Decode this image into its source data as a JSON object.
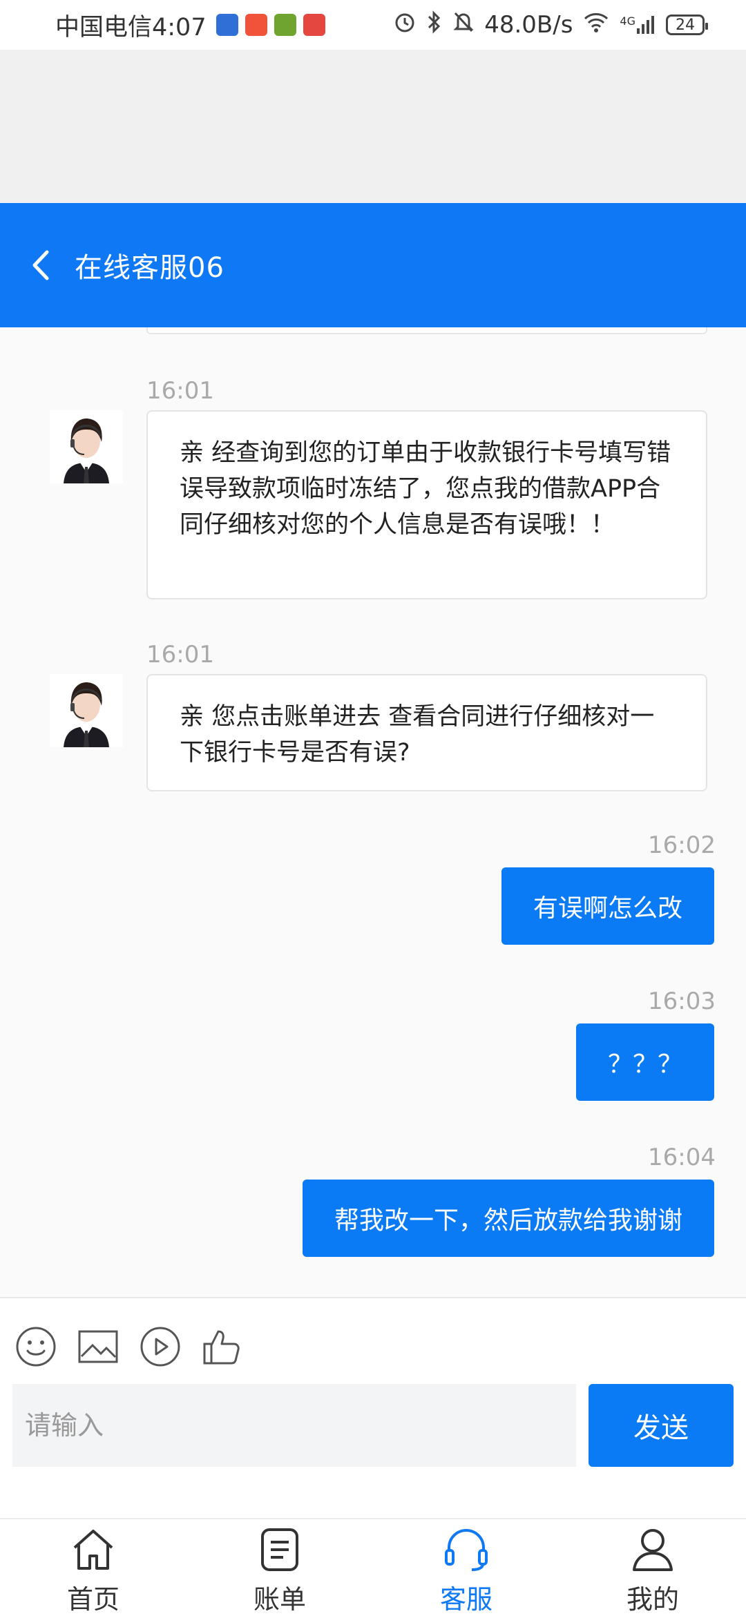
{
  "status_bar": {
    "carrier_time": "中国电信4:07",
    "network_speed": "48.0B/s",
    "network_type": "4G",
    "battery": "24",
    "icons": [
      "alarm-icon",
      "bluetooth-icon",
      "mute-icon",
      "wifi-icon",
      "signal-icon",
      "battery-icon"
    ]
  },
  "header": {
    "title": "在线客服06",
    "back_icon": "back-chevron-icon"
  },
  "messages": [
    {
      "side": "in",
      "time": "16:01",
      "text": "亲 经查询到您的订单由于收款银行卡号填写错误导致款项临时冻结了，您点我的借款APP合同仔细核对您的个人信息是否有误哦！！"
    },
    {
      "side": "in",
      "time": "16:01",
      "text": "亲 您点击账单进去 查看合同进行仔细核对一下银行卡号是否有误?"
    },
    {
      "side": "out",
      "time": "16:02",
      "text": "有误啊怎么改"
    },
    {
      "side": "out",
      "time": "16:03",
      "text": "？？？"
    },
    {
      "side": "out",
      "time": "16:04",
      "text": "帮我改一下，然后放款给我谢谢"
    }
  ],
  "composer": {
    "tools": [
      "emoji-icon",
      "image-icon",
      "video-icon",
      "thumbs-up-icon"
    ],
    "placeholder": "请输入",
    "send_label": "发送"
  },
  "nav": {
    "items": [
      {
        "label": "首页",
        "icon": "home-icon",
        "active": false
      },
      {
        "label": "账单",
        "icon": "bill-icon",
        "active": false
      },
      {
        "label": "客服",
        "icon": "headset-icon",
        "active": true
      },
      {
        "label": "我的",
        "icon": "user-icon",
        "active": false
      }
    ]
  },
  "colors": {
    "accent": "#0f78f5",
    "bubble_out": "#0a7bf5",
    "timestamp": "#a9a9a9"
  }
}
